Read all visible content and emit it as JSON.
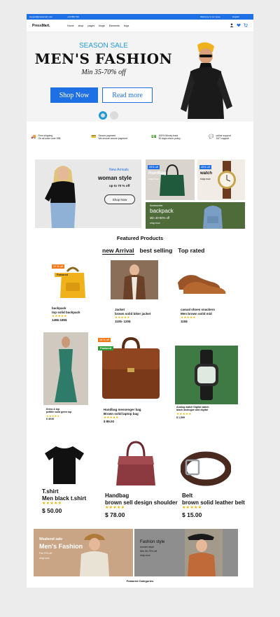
{
  "topbar": {
    "email": "support@pressmart.com",
    "phone": "+24 850 700",
    "welcome": "Welcome to our store",
    "language": "English"
  },
  "nav": {
    "logo": "PressMart.",
    "menu": [
      "Home",
      "shop",
      "pages",
      "blogs",
      "Elements",
      "buys"
    ]
  },
  "hero": {
    "season": "SEASON SALE",
    "title": "MEN'S FASHION",
    "subtitle": "Min 35-70% off",
    "shop_button": "Shop Now",
    "read_button": "Read more"
  },
  "features": [
    {
      "icon": "truck-icon",
      "line1": "Free shipping",
      "line2": "On all order over 99$"
    },
    {
      "icon": "card-icon",
      "line1": "Secure payment",
      "line2": "We ensure secure payment"
    },
    {
      "icon": "money-icon",
      "line1": "100% Money back",
      "line2": "30 days return policy"
    },
    {
      "icon": "chat-icon",
      "line1": "online support",
      "line2": "24/7 support"
    }
  ],
  "promo": {
    "main": {
      "kicker": "New Arrivals",
      "title": "woman style",
      "offer": "up to 70 % off",
      "button": "Shop Now"
    },
    "handbag": {
      "badge": "25% off",
      "title": "Handbag",
      "link": "shop now"
    },
    "watch": {
      "badge": "45% off",
      "title": "watch",
      "link": "shop now"
    },
    "backpack": {
      "kicker": "Accessories",
      "title": "backpack",
      "offer": "Min 40-80% off",
      "link": "shop now"
    }
  },
  "featured": {
    "title": "Featured Products",
    "tabs": [
      "new Arrival",
      "best selling",
      "Top rated"
    ]
  },
  "products_row1": [
    {
      "badge": "15 % off",
      "flag": "Featured",
      "name": "backpack",
      "desc": "top solid backpack",
      "stars": "★★★★★",
      "price": "149$-185$"
    },
    {
      "name": "Jacket",
      "desc": "brown solid biker jacket",
      "stars": "★★★★★",
      "price": "110$- 120$"
    },
    {
      "name": "casual shoes snackers",
      "desc": "Men brown solid mid",
      "stars": "★★★★★",
      "price": "115$"
    }
  ],
  "products_row2": [
    {
      "name": "Dress & top",
      "desc": "pettitle solid green top",
      "stars": "★★★★★",
      "price": "$ 49.00"
    },
    {
      "badge": "18 % off",
      "flag": "Featured",
      "name": "Handbag messenger bag",
      "desc": "Brown solid laptop bag",
      "stars": "★★★★★",
      "price": "$ 89.00"
    },
    {
      "name": "Analog watch Digital watch",
      "desc": "black analogue and digital",
      "stars": "★★★★★",
      "price": "$ 1,599"
    }
  ],
  "products_row3": [
    {
      "name": "T.shirt",
      "desc": "Men  black t.shirt",
      "stars": "★★★★★",
      "price": "$ 50.00"
    },
    {
      "name": "Handbag",
      "desc": "brown sell design shoulder",
      "stars": "★★★★★",
      "price": "$ 78.00"
    },
    {
      "name": "Belt",
      "desc": "brown solid leather belt",
      "stars": "★★★★★",
      "price": "$ 15.00"
    }
  ],
  "bottom": {
    "left": {
      "kicker": "Weakend sale",
      "title": "Men's Fashion",
      "offer": "Flat 70% off",
      "link": "shop now"
    },
    "right": {
      "title": "Fashion style",
      "kicker": "women style",
      "offer": "Min 30-70% off",
      "link": "shop now"
    }
  },
  "categories_title": "Featured Categories",
  "colors": {
    "accent": "#1f6fe5",
    "hero_kicker": "#1e9bd7",
    "star": "#e7b400",
    "discount": "#f07a1a",
    "featured": "#2f9a3a"
  }
}
